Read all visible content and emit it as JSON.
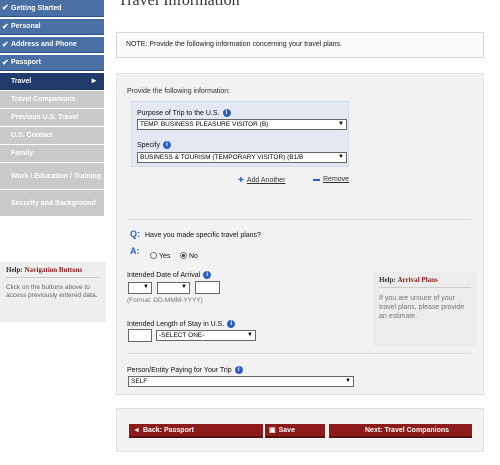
{
  "sidebar": {
    "items": [
      {
        "label": "Getting Started",
        "state": "done"
      },
      {
        "label": "Personal",
        "state": "done"
      },
      {
        "label": "Address and Phone",
        "state": "done"
      },
      {
        "label": "Passport",
        "state": "done"
      },
      {
        "label": "Travel",
        "state": "current"
      },
      {
        "label": "Travel Companions",
        "state": "pending"
      },
      {
        "label": "Previous U.S. Travel",
        "state": "pending"
      },
      {
        "label": "U.S. Contact",
        "state": "pending"
      },
      {
        "label": "Family",
        "state": "pending"
      },
      {
        "label": "Work / Education / Training",
        "state": "pending"
      },
      {
        "label": "Security and Background",
        "state": "pending"
      }
    ],
    "help": {
      "prefix": "Help:",
      "title": "Navigation Buttons",
      "text": "Click on the buttons above to access previously entered data."
    }
  },
  "page": {
    "title": "Travel Information",
    "note": "NOTE: Provide the following information concerning your travel plans."
  },
  "form": {
    "provide_label": "Provide the following information:",
    "purpose_label": "Purpose of Trip to the U.S.",
    "purpose_value": "TEMP. BUSINESS PLEASURE VISITOR (B)",
    "specify_label": "Specify",
    "specify_value": "BUSINESS & TOURISM (TEMPORARY VISITOR) (B1/B",
    "add_another": "Add Another",
    "remove": "Remove",
    "question_marker": "Q:",
    "question": "Have you made specific travel plans?",
    "answer_marker": "A:",
    "yes_label": "Yes",
    "no_label": "No",
    "selected": "No",
    "arrival_label": "Intended Date of Arrival",
    "date_format": "(Format: DD-MMM-YYYY)",
    "stay_label": "Intended Length of Stay in U.S.",
    "stay_select": "-SELECT ONE-",
    "payer_label": "Person/Entity Paying for Your Trip",
    "payer_value": "SELF"
  },
  "help_arrival": {
    "prefix": "Help:",
    "title": "Arrival Plans",
    "text": "If you are unsure of your travel plans, please provide an estimate."
  },
  "buttons": {
    "back": "Back: Passport",
    "save": "Save",
    "next": "Next: Travel Companions"
  },
  "icons": {
    "check": "check-icon",
    "arrow": "arrow-right-icon",
    "info": "info-icon"
  },
  "colors": {
    "nav_done": "#4a6fa5",
    "nav_current": "#1f3a6b",
    "nav_pending": "#c9c9c9",
    "button": "#8e1b1b",
    "help_title": "#8b1a1a"
  }
}
